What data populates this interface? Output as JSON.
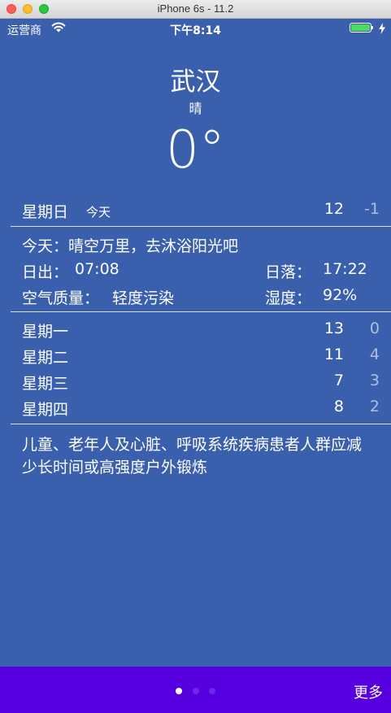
{
  "window": {
    "title": "iPhone 6s - 11.2"
  },
  "statusbar": {
    "carrier": "运营商",
    "time": "下午8:14"
  },
  "weather": {
    "city": "武汉",
    "condition": "晴",
    "temperature": "0°"
  },
  "today_row": {
    "day": "星期日",
    "tag": "今天",
    "high": "12",
    "low": "-1"
  },
  "details": {
    "summary": "今天：晴空万里，去沐浴阳光吧",
    "sunrise_label": "日出：",
    "sunrise": "07:08",
    "sunset_label": "日落：",
    "sunset": "17:22",
    "aqi_label": "空气质量：",
    "aqi": "轻度污染",
    "humidity_label": "湿度：",
    "humidity": "92%"
  },
  "forecast": [
    {
      "day": "星期一",
      "high": "13",
      "low": "0"
    },
    {
      "day": "星期二",
      "high": "11",
      "low": "4"
    },
    {
      "day": "星期三",
      "high": "7",
      "low": "3"
    },
    {
      "day": "星期四",
      "high": "8",
      "low": "2"
    }
  ],
  "advice": "儿童、老年人及心脏、呼吸系统疾病患者人群应减少长时间或高强度户外锻炼",
  "bottombar": {
    "more_label": "更多",
    "page_count": 3,
    "current_page": 1
  },
  "colors": {
    "background": "#3a5fad",
    "bottombar": "#5600e0",
    "battery": "#4cd964",
    "low_temp": "#aebedf"
  },
  "icons": [
    "wifi-icon",
    "battery-icon",
    "charging-bolt-icon",
    "page-dot-icon"
  ]
}
